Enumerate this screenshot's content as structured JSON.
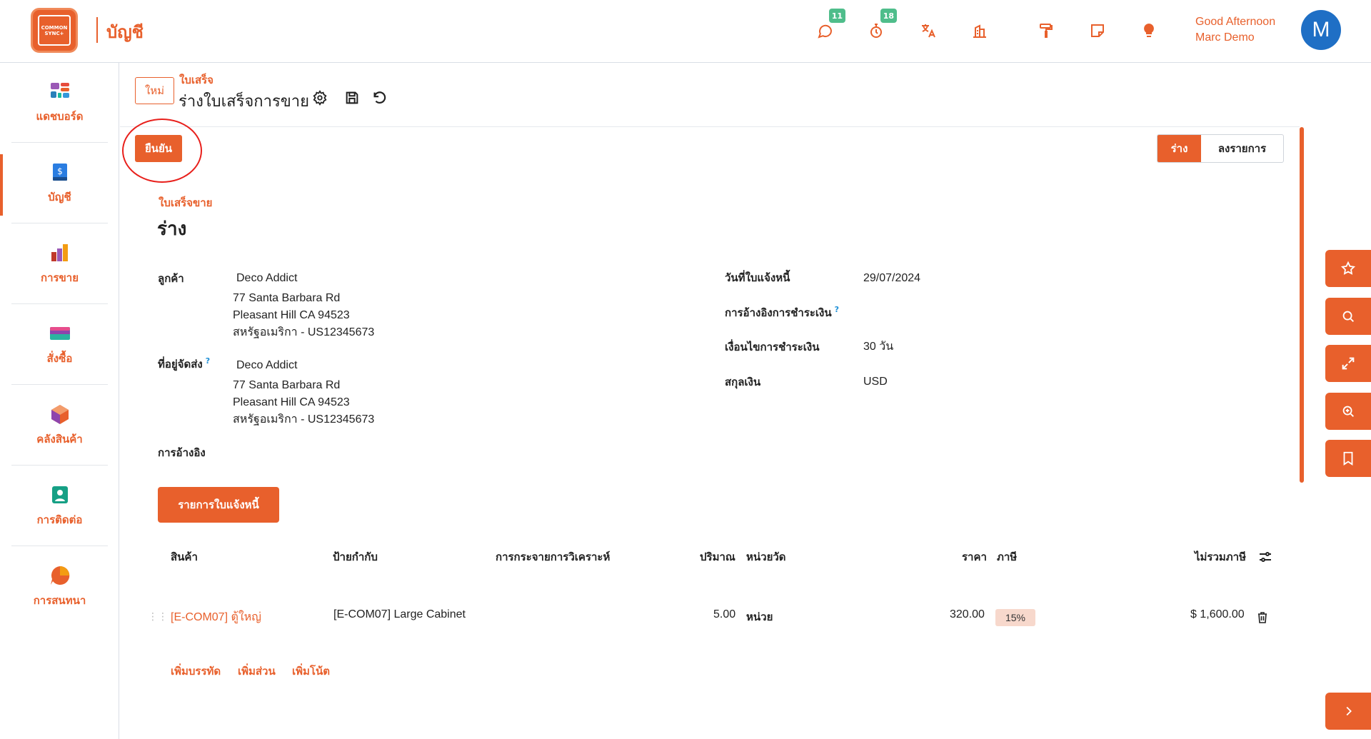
{
  "header": {
    "logo_text_line1": "COMMON",
    "logo_text_line2": "SYNC+",
    "app_title": "บัญชี",
    "badges": {
      "messages": "11",
      "activities": "18"
    },
    "greeting_line1": "Good Afternoon",
    "greeting_line2": "Marc Demo",
    "avatar_initial": "M"
  },
  "sidebar": {
    "items": [
      {
        "label": "แดชบอร์ด",
        "icon": "dashboard-icon"
      },
      {
        "label": "บัญชี",
        "icon": "accounting-icon"
      },
      {
        "label": "การขาย",
        "icon": "sales-icon"
      },
      {
        "label": "สั่งซื้อ",
        "icon": "purchase-icon"
      },
      {
        "label": "คลังสินค้า",
        "icon": "inventory-icon"
      },
      {
        "label": "การติดต่อ",
        "icon": "contacts-icon"
      },
      {
        "label": "การสนทนา",
        "icon": "discuss-icon"
      }
    ]
  },
  "breadcrumb": {
    "new_label": "ใหม่",
    "parent": "ใบเสร็จ",
    "current": "ร่างใบเสร็จการขาย"
  },
  "actions": {
    "confirm_label": "ยืนยัน"
  },
  "status": {
    "active": "ร่าง",
    "inactive": "ลงรายการ"
  },
  "form": {
    "doc_type": "ใบเสร็จขาย",
    "doc_name": "ร่าง",
    "customer_label": "ลูกค้า",
    "customer": {
      "name": "Deco Addict",
      "line1": "77 Santa Barbara Rd",
      "line2": "Pleasant Hill CA 94523",
      "line3": "สหรัฐอเมริกา - US12345673"
    },
    "shipping_label": "ที่อยู่จัดส่ง",
    "shipping": {
      "name": "Deco Addict",
      "line1": "77 Santa Barbara Rd",
      "line2": "Pleasant Hill CA 94523",
      "line3": "สหรัฐอเมริกา - US12345673"
    },
    "reference_label": "การอ้างอิง",
    "invoice_date_label": "วันที่ใบแจ้งหนี้",
    "invoice_date": "29/07/2024",
    "payment_ref_label": "การอ้างอิงการชำระเงิน",
    "payment_terms_label": "เงื่อนไขการชำระเงิน",
    "payment_terms": "30 วัน",
    "currency_label": "สกุลเงิน",
    "currency": "USD",
    "help_mark": "?"
  },
  "tab": {
    "label": "รายการใบแจ้งหนี้"
  },
  "table": {
    "headers": {
      "product": "สินค้า",
      "label": "ป้ายกำกับ",
      "analytic": "การกระจายการวิเคราะห์",
      "qty": "ปริมาณ",
      "uom": "หน่วยวัด",
      "price": "ราคา",
      "tax": "ภาษี",
      "subtotal": "ไม่รวมภาษี"
    },
    "rows": [
      {
        "product": "[E-COM07] ตู้ใหญ่",
        "label": "[E-COM07] Large Cabinet",
        "qty": "5.00",
        "uom": "หน่วย",
        "price": "320.00",
        "tax": "15%",
        "subtotal": "$ 1,600.00"
      }
    ],
    "add_line": "เพิ่มบรรทัด",
    "add_section": "เพิ่มส่วน",
    "add_note": "เพิ่มโน้ต"
  },
  "colors": {
    "accent": "#e8602c",
    "badge": "#4fbd8b",
    "avatar": "#1f6fc5"
  }
}
